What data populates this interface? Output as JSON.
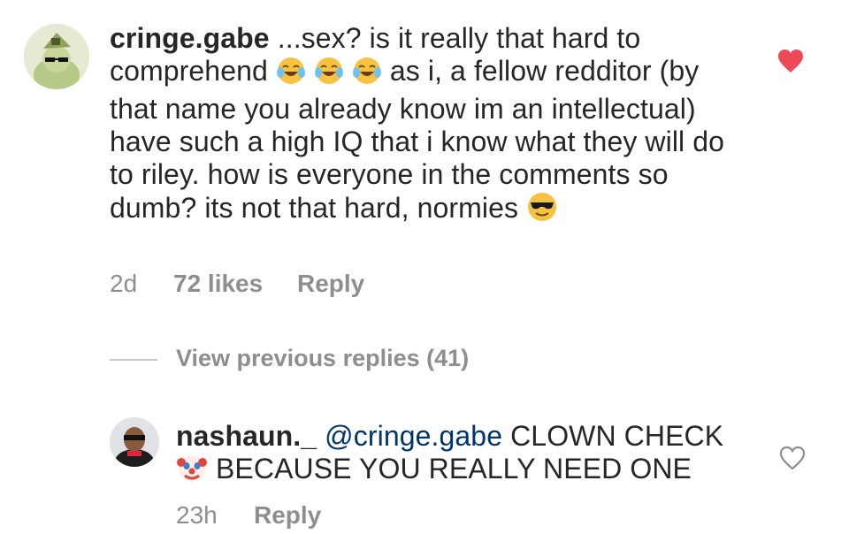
{
  "comment": {
    "username": "cringe.gabe",
    "text_part1": " ...sex? is it really that hard to comprehend ",
    "emoji_sequence": [
      "tears-of-joy",
      "tears-of-joy",
      "tears-of-joy"
    ],
    "text_part2": " as i, a fellow redditor (by that name you already know im an intellectual) have such a high IQ that i know what they will do to riley. how is everyone in the comments so dumb? its not that hard, normies ",
    "end_emoji": "sunglasses-face",
    "age": "2d",
    "likes": "72 likes",
    "reply_label": "Reply",
    "liked": true,
    "heart_color": "#ed4956"
  },
  "view_previous": "View previous replies (41)",
  "reply": {
    "username": "nashaun._",
    "mention": "@cringe.gabe",
    "text_part1": " CLOWN CHECK ",
    "emoji": "clown-face",
    "text_part2": " BECAUSE YOU REALLY NEED ONE",
    "age": "23h",
    "reply_label": "Reply",
    "liked": false
  },
  "colors": {
    "text": "#262626",
    "meta": "#8e8e8e",
    "mention": "#003569",
    "divider": "#c7c7c7"
  }
}
